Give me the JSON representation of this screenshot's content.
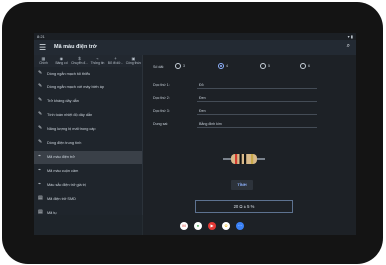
{
  "status_bar": {
    "time": "8:21",
    "icons": "▾ ▮"
  },
  "app_bar": {
    "title": "Mã màu điện trở",
    "menu_icon": "menu-icon",
    "search_icon": "search-icon"
  },
  "top_tabs": [
    {
      "icon": "grid-icon",
      "label": "Chính"
    },
    {
      "icon": "eye-icon",
      "label": "Bảng cd"
    },
    {
      "icon": "dollar-icon",
      "label": "Chuyển đ..."
    },
    {
      "icon": "resistor-icon",
      "label": "Thông tin"
    },
    {
      "icon": "plus-icon",
      "label": "Bổ đt dữ..."
    },
    {
      "icon": "tools-icon",
      "label": "Công thức"
    }
  ],
  "sidebar": [
    {
      "icon": "wrench-icon",
      "label": "Dòng ngắn mạch tối thiểu",
      "active": false
    },
    {
      "icon": "wrench-icon",
      "label": "Dòng ngắn mạch với máy biến áp",
      "active": false
    },
    {
      "icon": "wrench-icon",
      "label": "Trở kháng dây dẫn",
      "active": false
    },
    {
      "icon": "wrench-icon",
      "label": "Tính toán nhiệt độ dây dẫn",
      "active": false
    },
    {
      "icon": "wrench-icon",
      "label": "Năng lượng bị mất trong cáp",
      "active": false
    },
    {
      "icon": "wrench-icon",
      "label": "Dòng điện trung tính",
      "active": false
    },
    {
      "icon": "resistor-icon",
      "label": "Mã màu điện trở",
      "active": true
    },
    {
      "icon": "resistor-icon",
      "label": "Mã màu cuộn cảm",
      "active": false
    },
    {
      "icon": "resistor-icon",
      "label": "Màu sắc điện trở giá trị",
      "active": false
    },
    {
      "icon": "chip-icon",
      "label": "Mã điện trở SMD",
      "active": false
    },
    {
      "icon": "chip-icon",
      "label": "Mã tụ",
      "active": false
    }
  ],
  "content": {
    "num_bands_label": "Số dải:",
    "band_options": [
      "3",
      "4",
      "5",
      "6"
    ],
    "selected_bands": "4",
    "bands": [
      {
        "label": "Dọc thứ 1:",
        "value": "Đỏ"
      },
      {
        "label": "Dọc thứ 2:",
        "value": "Đen"
      },
      {
        "label": "Dọc thứ 3:",
        "value": "Đen"
      },
      {
        "label": "Dung sai:",
        "value": "Bằng đinh kim"
      }
    ],
    "calculate_label": "TÍNH",
    "result": "20 Ω ± 5 %"
  },
  "resistor_colors": [
    "#d33b2f",
    "#111111",
    "#111111",
    "#c8a94a"
  ],
  "dock_apps": [
    {
      "name": "gmail-icon",
      "glyph": "M",
      "color": "#ffffff"
    },
    {
      "name": "chrome-icon",
      "glyph": "●",
      "color": "#2ea043"
    },
    {
      "name": "youtube-icon",
      "glyph": "▶",
      "color": "#e53935"
    },
    {
      "name": "photos-icon",
      "glyph": "✿",
      "color": "#f2c744"
    },
    {
      "name": "apps-icon",
      "glyph": "⋯",
      "color": "#3b82f6"
    }
  ]
}
